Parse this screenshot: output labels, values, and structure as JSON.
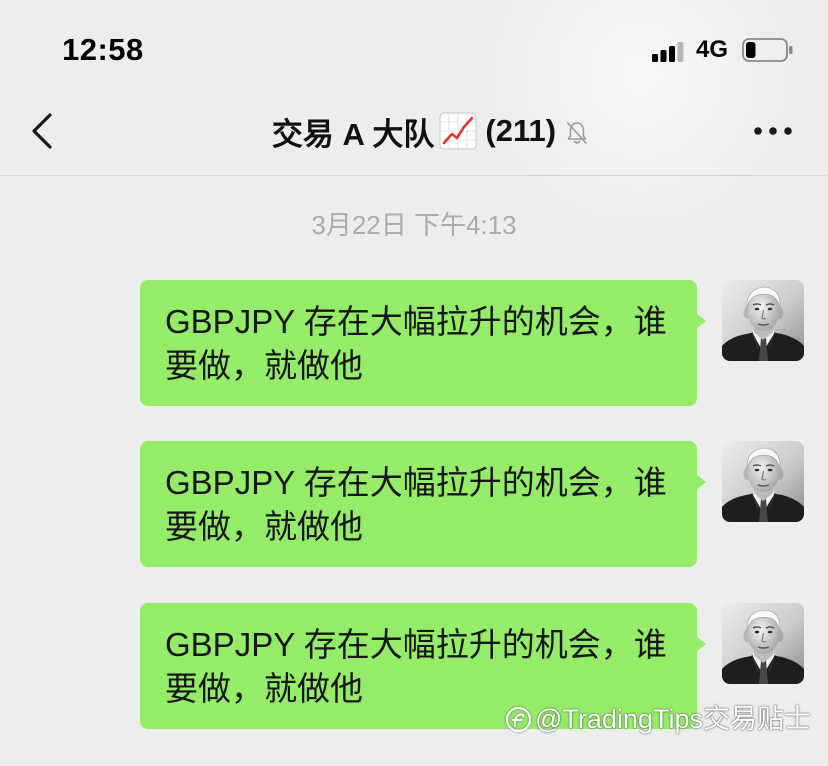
{
  "status_bar": {
    "time": "12:58",
    "network": "4G",
    "signal_icon": "cellular-signal-icon",
    "signal_bars_active": 3,
    "signal_bars_total": 4,
    "battery_icon": "battery-icon",
    "battery_level": 0.25
  },
  "nav": {
    "back_icon": "chevron-left-icon",
    "group_name": "交易 A 大队",
    "title_emoji_icon": "chart-increasing-icon",
    "member_count": "(211)",
    "muted_icon": "bell-slash-icon",
    "more_icon": "more-dots-icon"
  },
  "chat": {
    "timestamp": "3月22日 下午4:13",
    "messages": [
      {
        "text": "GBPJPY 存在大幅拉升的机会，谁要做，就做他",
        "sender_avatar": "avatar-portrait"
      },
      {
        "text": "GBPJPY 存在大幅拉升的机会，谁要做，就做他",
        "sender_avatar": "avatar-portrait"
      },
      {
        "text": "GBPJPY 存在大幅拉升的机会，谁要做，就做他",
        "sender_avatar": "avatar-portrait"
      }
    ]
  },
  "watermark": {
    "icon": "watermark-logo-icon",
    "text": "@TradingTips交易贴士"
  },
  "colors": {
    "background": "#EDEDED",
    "bubble": "#95EC69",
    "timestamp": "#ACACAC"
  }
}
